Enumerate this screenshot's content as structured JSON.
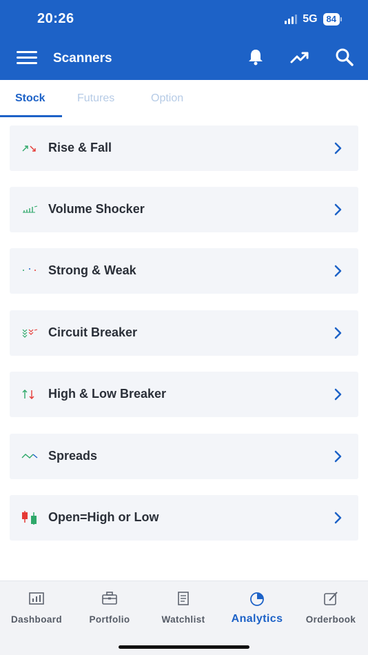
{
  "status_bar": {
    "time": "20:26",
    "network": "5G",
    "battery": "84"
  },
  "header": {
    "title": "Scanners",
    "icons": [
      "menu-icon",
      "bell-icon",
      "trending-up-icon",
      "search-icon"
    ]
  },
  "tabs": [
    {
      "label": "Stock",
      "active": true
    },
    {
      "label": "Futures",
      "active": false
    },
    {
      "label": "Option",
      "active": false
    }
  ],
  "scanners": [
    {
      "label": "Rise & Fall",
      "icon": "rise-fall-icon"
    },
    {
      "label": "Volume Shocker",
      "icon": "volume-bars-icon"
    },
    {
      "label": "Strong & Weak",
      "icon": "dots-icon"
    },
    {
      "label": "Circuit Breaker",
      "icon": "chevrons-icon"
    },
    {
      "label": "High & Low Breaker",
      "icon": "up-down-arrows-icon"
    },
    {
      "label": "Spreads",
      "icon": "wave-icon"
    },
    {
      "label": "Open=High or Low",
      "icon": "candlestick-icon"
    }
  ],
  "bottom_nav": [
    {
      "label": "Dashboard",
      "icon": "dashboard-icon",
      "active": false
    },
    {
      "label": "Portfolio",
      "icon": "briefcase-icon",
      "active": false
    },
    {
      "label": "Watchlist",
      "icon": "list-icon",
      "active": false
    },
    {
      "label": "Analytics",
      "icon": "pie-chart-icon",
      "active": true
    },
    {
      "label": "Orderbook",
      "icon": "edit-icon",
      "active": false
    }
  ],
  "colors": {
    "primary": "#1d62c7",
    "up": "#2ea86a",
    "down": "#e53935",
    "item_bg": "#f3f5f9"
  }
}
